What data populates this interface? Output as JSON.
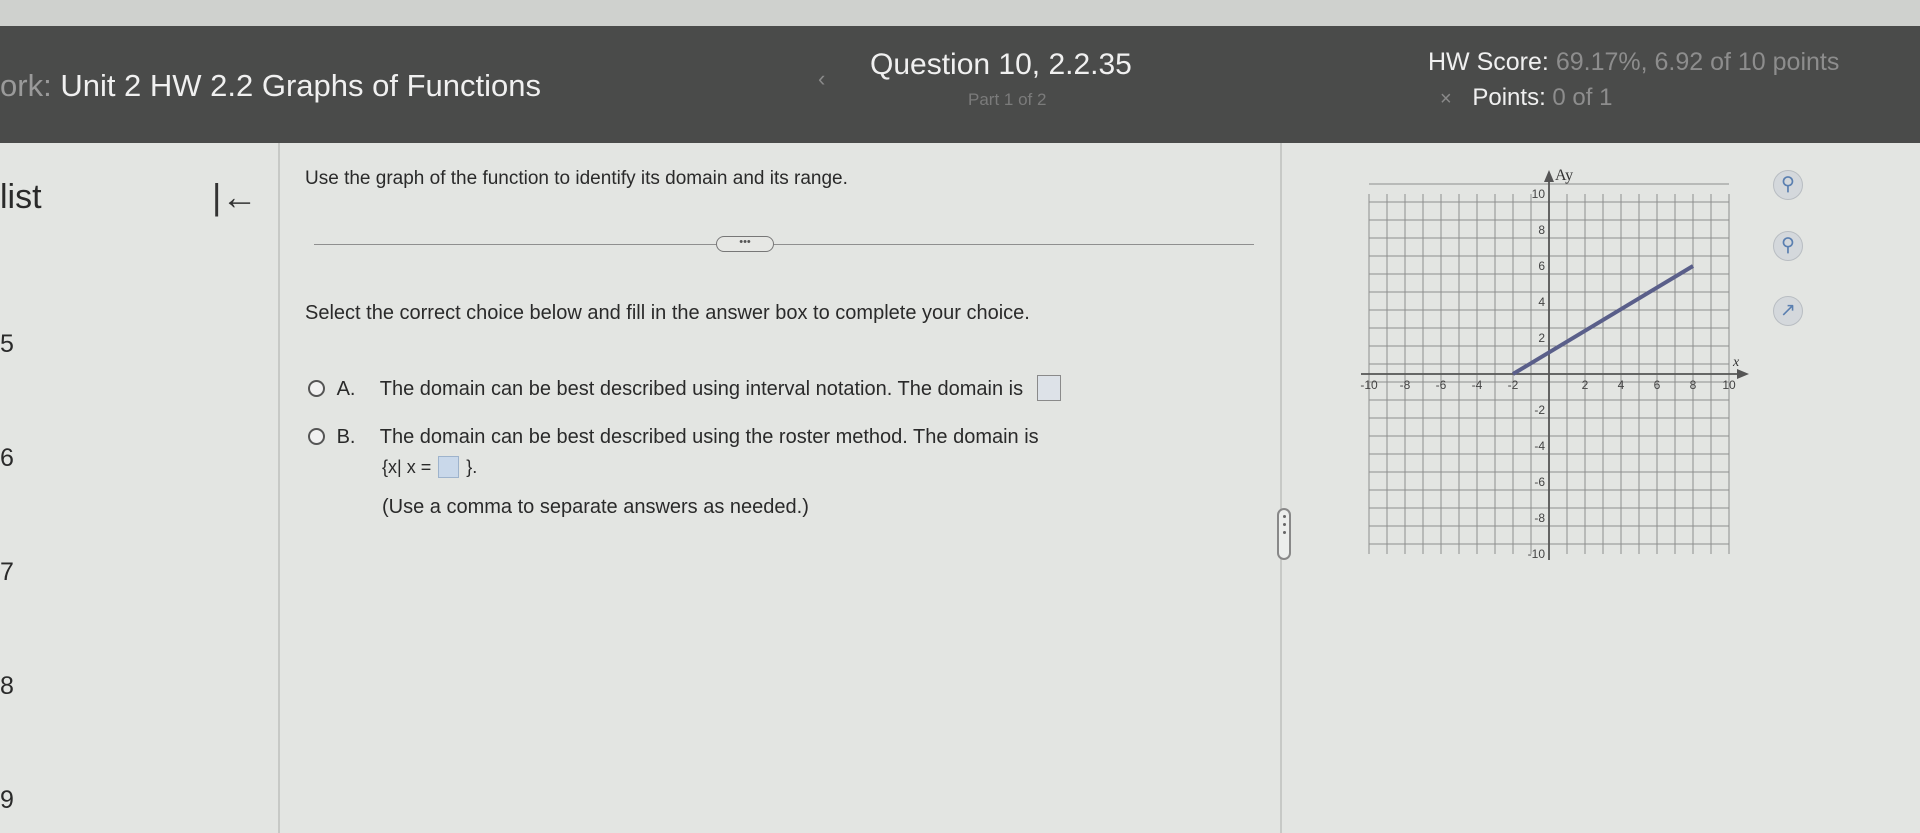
{
  "header": {
    "prefix": "ork:",
    "title": "Unit 2 HW 2.2 Graphs of Functions",
    "question_label": "Question 10, 2.2.35",
    "part_label": "Part 1 of 2",
    "prev_arrow": "‹",
    "score_label": "HW Score:",
    "score_value": "69.17%, 6.92 of 10 points",
    "points_label": "Points:",
    "points_value": "0 of 1",
    "points_icon": "×"
  },
  "sidebar": {
    "title": "list",
    "collapse_icon": "|←",
    "items": [
      "5",
      "6",
      "7",
      "8",
      "9"
    ]
  },
  "question": {
    "prompt": "Use the graph of the function to identify its domain and its range.",
    "more_label": "•••",
    "instruction": "Select the correct choice below and fill in the answer box to complete your choice.",
    "choice_a_letter": "A.",
    "choice_a_text": "The domain can be best described using interval notation. The domain is",
    "choice_b_letter": "B.",
    "choice_b_text": "The domain can be best described using the roster method. The domain is",
    "set_open": "{x| x =",
    "set_close": "}.",
    "note": "(Use a comma to separate answers as needed.)"
  },
  "graph": {
    "y_axis_label": "Ay",
    "x_axis_label": "x",
    "x_ticks": [
      "-10",
      "-8",
      "-6",
      "-4",
      "-2",
      "2",
      "4",
      "6",
      "8",
      "10"
    ],
    "y_ticks": [
      "10",
      "8",
      "6",
      "4",
      "2",
      "-2",
      "-4",
      "-6",
      "-8",
      "-10"
    ],
    "line_color": "#5a5f8a",
    "grid_color": "#8e8e8e",
    "line_points": [
      [
        -2,
        0
      ],
      [
        8,
        6
      ]
    ]
  },
  "tools": [
    "zoom-in-icon",
    "zoom-out-icon",
    "external-link-icon"
  ]
}
